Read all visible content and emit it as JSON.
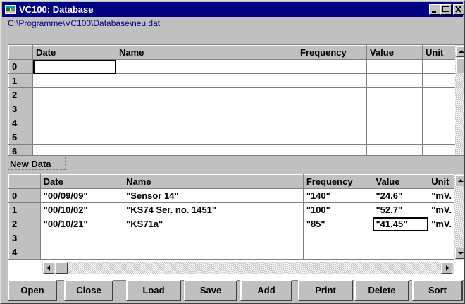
{
  "window": {
    "title": "VC100: Database",
    "path": "C:\\Programme\\VC100\\Database\\neu.dat"
  },
  "top_grid": {
    "headers": [
      "Date",
      "Name",
      "Frequency",
      "Value",
      "Unit"
    ],
    "row_labels": [
      "0",
      "1",
      "2",
      "3",
      "4",
      "5",
      "6"
    ],
    "rows": [
      [
        "",
        "",
        "",
        "",
        ""
      ],
      [
        "",
        "",
        "",
        "",
        ""
      ],
      [
        "",
        "",
        "",
        "",
        ""
      ],
      [
        "",
        "",
        "",
        "",
        ""
      ],
      [
        "",
        "",
        "",
        "",
        ""
      ],
      [
        "",
        "",
        "",
        "",
        ""
      ],
      [
        "",
        "",
        "",
        "",
        ""
      ]
    ]
  },
  "new_data_label": "New Data",
  "bottom_grid": {
    "headers": [
      "Date",
      "Name",
      "Frequency",
      "Value",
      "Unit"
    ],
    "row_labels": [
      "0",
      "1",
      "2",
      "3",
      "4"
    ],
    "rows": [
      [
        "\"00/09/09\"",
        "\"Sensor 14\"",
        "\"140\"",
        "\"24.6\"",
        "\"mV."
      ],
      [
        "\"00/10/02\"",
        "\"KS74 Ser. no. 1451\"",
        "\"100\"",
        "\"52.7\"",
        "\"mV."
      ],
      [
        "\"00/10/21\"",
        "\"KS71a\"",
        "\"85\"",
        "\"41.45\"",
        "\"mV."
      ],
      [
        "",
        "",
        "",
        "",
        ""
      ],
      [
        "",
        "",
        "",
        "",
        ""
      ]
    ]
  },
  "buttons": [
    "Open",
    "Close",
    "Load",
    "Save",
    "Add",
    "Print",
    "Delete",
    "Sort"
  ],
  "icons": {
    "app": "database-app-icon",
    "minimize": "minimize-icon",
    "maximize": "maximize-icon",
    "close": "close-icon"
  }
}
